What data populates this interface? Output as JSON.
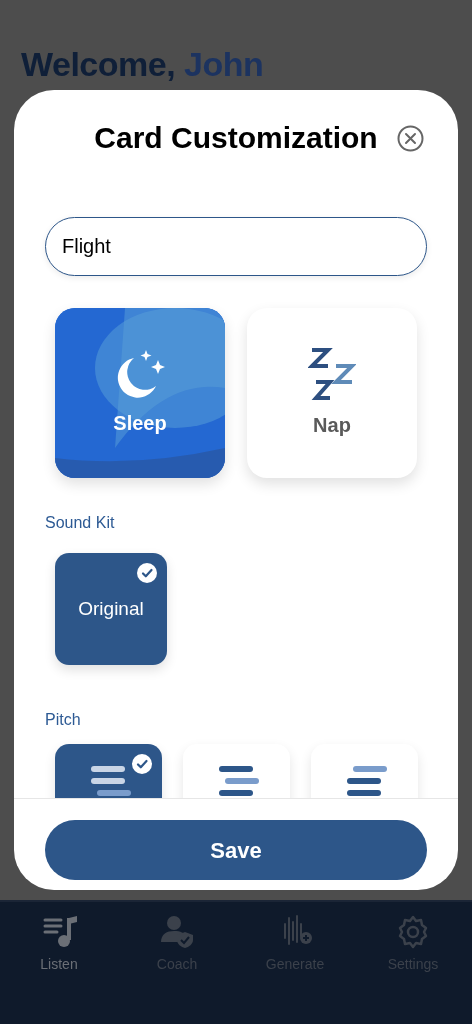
{
  "background": {
    "greeting": "Welcome,",
    "name": "John"
  },
  "modal": {
    "title": "Card Customization",
    "name_field": {
      "value": "Flight"
    },
    "card_types": [
      {
        "label": "Sleep",
        "kind": "sleep",
        "selected": true
      },
      {
        "label": "Nap",
        "kind": "nap",
        "selected": false
      }
    ],
    "sound_kit": {
      "label": "Sound Kit",
      "options": [
        {
          "label": "Original",
          "selected": true
        }
      ]
    },
    "pitch": {
      "label": "Pitch",
      "options": [
        {
          "kind": "low",
          "selected": true
        },
        {
          "kind": "mid",
          "selected": false
        },
        {
          "kind": "high",
          "selected": false
        }
      ]
    },
    "save_button": "Save"
  },
  "tab_bar": [
    {
      "label": "Listen",
      "kind": "listen",
      "selected": true
    },
    {
      "label": "Coach",
      "kind": "coach",
      "selected": false
    },
    {
      "label": "Generate",
      "kind": "generate",
      "selected": false
    },
    {
      "label": "Settings",
      "kind": "settings",
      "selected": false
    }
  ]
}
